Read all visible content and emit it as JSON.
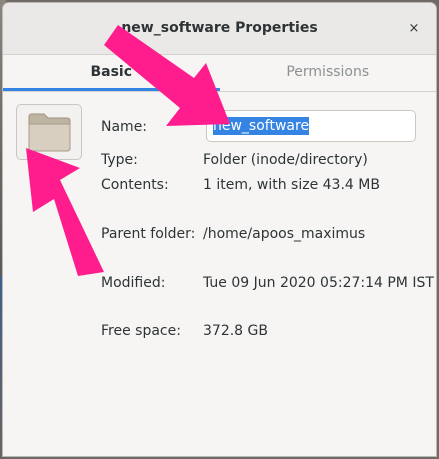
{
  "window": {
    "title": "new_software Properties",
    "close_icon": "×"
  },
  "tabs": [
    {
      "label": "Basic",
      "active": true
    },
    {
      "label": "Permissions",
      "active": false
    }
  ],
  "icon": {
    "name": "folder-icon",
    "color": "#d2c7b6"
  },
  "fields": {
    "name_label": "Name:",
    "name_value": "new_software",
    "type_label": "Type:",
    "type_value": "Folder (inode/directory)",
    "contents_label": "Contents:",
    "contents_value": "1 item, with size 43.4 MB",
    "parent_label": "Parent folder:",
    "parent_value": "/home/apoos_maximus",
    "modified_label": "Modified:",
    "modified_value": "Tue 09 Jun 2020 05:27:14 PM IST",
    "free_label": "Free space:",
    "free_value": "372.8 GB"
  },
  "colors": {
    "accent": "#3584e4",
    "annotation_arrow": "#ff1d8e"
  }
}
